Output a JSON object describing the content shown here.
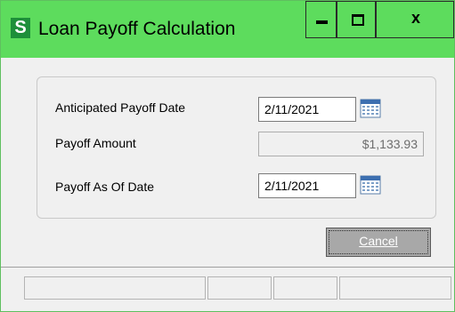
{
  "window": {
    "title": "Loan Payoff Calculation",
    "icon_letter": "S",
    "controls": {
      "minimize_icon": "minimize-icon",
      "maximize_icon": "maximize-icon",
      "close_label": "x"
    },
    "accent_color": "#5ddc5d"
  },
  "form": {
    "anticipated_payoff_date": {
      "label": "Anticipated Payoff Date",
      "value": "2/11/2021",
      "icon": "calendar-icon"
    },
    "payoff_amount": {
      "label": "Payoff Amount",
      "value": "$1,133.93"
    },
    "payoff_as_of_date": {
      "label": "Payoff As Of Date",
      "value": "2/11/2021",
      "icon": "calendar-icon"
    }
  },
  "buttons": {
    "cancel_label": "Cancel"
  },
  "statusbar": {
    "segments": [
      "",
      "",
      "",
      ""
    ]
  }
}
